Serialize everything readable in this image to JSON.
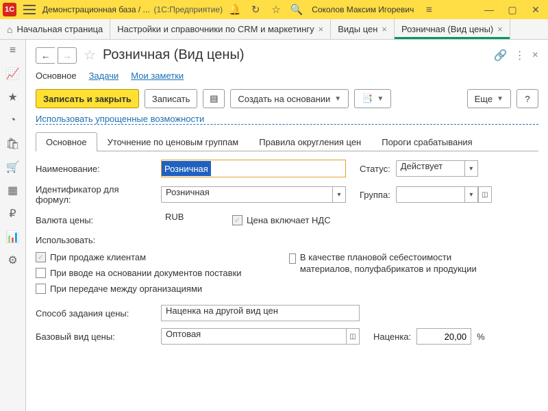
{
  "titlebar": {
    "db_title": "Демонстрационная база / ...",
    "app_label": "(1С:Предприятие)",
    "user_name": "Соколов Максим Игоревич"
  },
  "navtabs": {
    "home": "Начальная страница",
    "crm": "Настройки и справочники по CRM и маркетингу",
    "price_types": "Виды цен",
    "retail": "Розничная (Вид цены)"
  },
  "page": {
    "title": "Розничная (Вид цены)"
  },
  "section_nav": {
    "main": "Основное",
    "tasks": "Задачи",
    "notes": "Мои заметки"
  },
  "toolbar": {
    "save_close": "Записать и закрыть",
    "save": "Записать",
    "create_based": "Создать на основании",
    "more": "Еще",
    "help": "?"
  },
  "simplified_link": "Использовать упрощенные возможности",
  "inner_tabs": {
    "main": "Основное",
    "groups": "Уточнение по ценовым группам",
    "rounding": "Правила округления цен",
    "thresholds": "Пороги срабатывания"
  },
  "form": {
    "name_label": "Наименование:",
    "name_value": "Розничная",
    "status_label": "Статус:",
    "status_value": "Действует",
    "formula_id_label": "Идентификатор для формул:",
    "formula_id_value": "Розничная",
    "group_label": "Группа:",
    "group_value": "",
    "currency_label": "Валюта цены:",
    "currency_value": "RUB",
    "vat_label": "Цена включает НДС",
    "use_label": "Использовать:",
    "chk_sales": "При продаже клиентам",
    "chk_plan_cost": "В качестве плановой себестоимости материалов, полуфабрикатов и продукции",
    "chk_supply_docs": "При вводе на основании документов поставки",
    "chk_transfer": "При передаче между организациями",
    "price_method_label": "Способ задания цены:",
    "price_method_value": "Наценка на другой вид цен",
    "base_price_label": "Базовый вид цены:",
    "base_price_value": "Оптовая",
    "markup_label": "Наценка:",
    "markup_value": "20,00",
    "markup_unit": "%"
  }
}
